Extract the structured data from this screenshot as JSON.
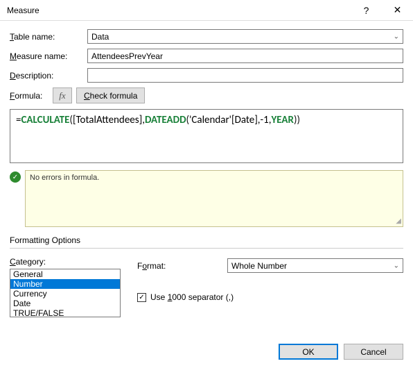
{
  "title": "Measure",
  "labels": {
    "table_name": "Table name:",
    "measure_name": "Measure name:",
    "description": "Description:",
    "formula": "Formula:",
    "check_formula": "Check formula",
    "formatting_options": "Formatting Options",
    "category": "Category:",
    "format": "Format:",
    "use_sep": "Use 1000 separator (,)",
    "ok": "OK",
    "cancel": "Cancel"
  },
  "fields": {
    "table_name": "Data",
    "measure_name": "AttendeesPrevYear",
    "description": "",
    "fx": "fx"
  },
  "formula": {
    "eq": "=",
    "fn1": "CALCULATE",
    "open1": "(",
    "arg1": "[TotalAttendees],",
    "fn2": "DATEADD",
    "open2": "(",
    "arg2": "'Calendar'[Date],-1,",
    "fn3": "YEAR",
    "close": "))"
  },
  "status": {
    "check": "✓",
    "message": "No errors in formula."
  },
  "category_list": [
    "General",
    "Number",
    "Currency",
    "Date",
    "TRUE/FALSE"
  ],
  "category_selected": "Number",
  "format_value": "Whole Number",
  "use_sep_checked": "✓"
}
